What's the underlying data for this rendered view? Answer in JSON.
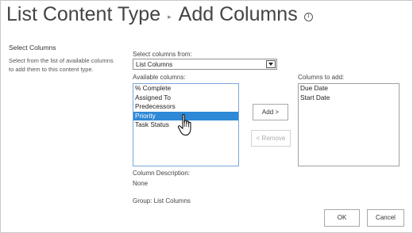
{
  "header": {
    "title": "List Content Type",
    "separator": "▸",
    "subtitle": "Add Columns",
    "info_icon": "info-icon"
  },
  "section": {
    "title": "Select Columns",
    "description": "Select from the list of available columns to add them to this content type."
  },
  "columns_from": {
    "label": "Select columns from:",
    "selected": "List Columns"
  },
  "available": {
    "label": "Available columns:",
    "items": [
      "% Complete",
      "Assigned To",
      "Predecessors",
      "Priority",
      "Task Status"
    ],
    "selected_item": "Priority"
  },
  "to_add": {
    "label": "Columns to add:",
    "items": [
      "Due Date",
      "Start Date"
    ]
  },
  "buttons": {
    "add": "Add >",
    "remove": "< Remove",
    "ok": "OK",
    "cancel": "Cancel"
  },
  "details": {
    "description_label": "Column Description:",
    "description_value": "None",
    "group": "Group: List Columns"
  },
  "colors": {
    "selection": "#2e89d6",
    "text": "#444444",
    "border": "#a8a8a8"
  }
}
